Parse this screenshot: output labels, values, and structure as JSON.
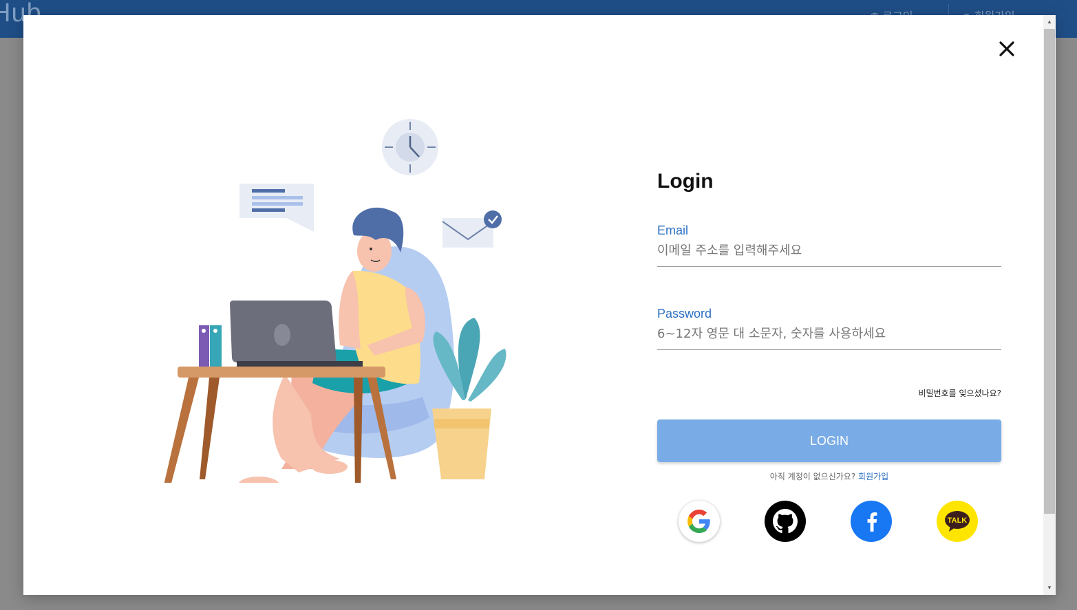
{
  "app": {
    "logo": "Hub",
    "nav_login": "로그인",
    "nav_signup": "회원가입"
  },
  "login": {
    "title": "Login",
    "email_label": "Email",
    "email_placeholder": "이메일 주소를 입력해주세요",
    "password_label": "Password",
    "password_placeholder": "6~12자 영문 대 소문자, 숫자를 사용하세요",
    "forgot_password": "비밀번호를 잊으셨나요?",
    "login_button": "LOGIN",
    "no_account_text": "아직 계정이 없으신가요?",
    "signup_link": "회원가입"
  },
  "social": {
    "kakao_label": "TALK",
    "google_icon": "google-icon",
    "github_icon": "github-icon",
    "facebook_icon": "facebook-icon",
    "kakao_icon": "kakaotalk-icon"
  },
  "colors": {
    "header": "#1f4e87",
    "accent": "#2b6fc3",
    "login_button": "#79ace6",
    "facebook": "#1877f2",
    "kakao": "#fee500"
  }
}
